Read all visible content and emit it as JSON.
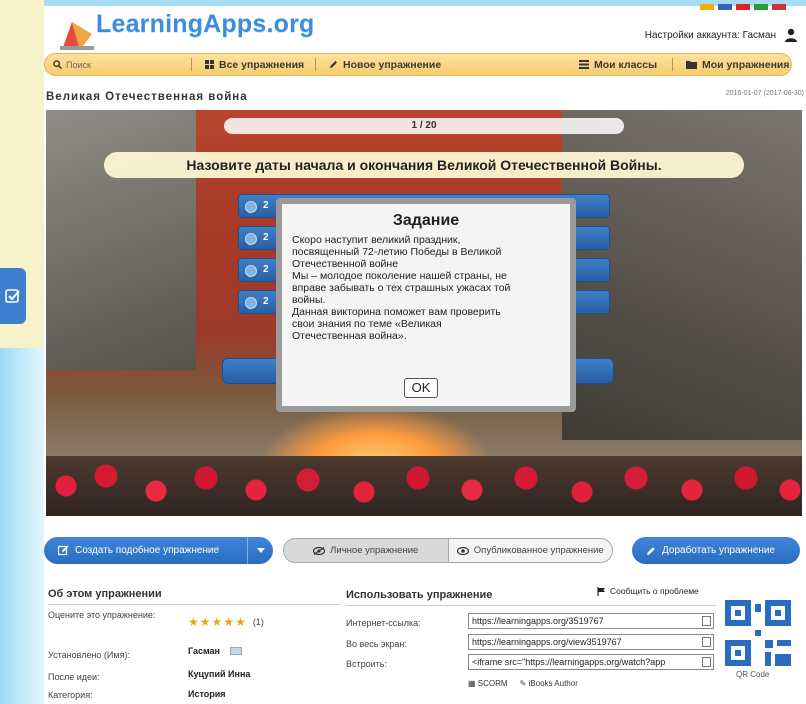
{
  "header": {
    "logo": "LearningApps.org",
    "account_label": "Настройки аккаунта: Гасман"
  },
  "nav": {
    "search_placeholder": "Поиск",
    "all_exercises": "Все упражнения",
    "new_exercise": "Новое упражнение",
    "my_classes": "Мои классы",
    "my_exercises": "Мои упражнения"
  },
  "exercise": {
    "title": "Великая Отечественная война",
    "date": "2016-01-07 (2017-06-30)"
  },
  "stage": {
    "counter": "1 / 20",
    "question": "Назовите даты начала и окончания Великой Отечественной Войны.",
    "answers": [
      "2",
      "2",
      "2",
      "2"
    ]
  },
  "modal": {
    "title": "Задание",
    "lines": [
      "Скоро наступит великий праздник,",
      "посвященный 72-летию Победы в Великой",
      "Отечественной войне",
      "Мы – молодое поколение нашей страны, не",
      "вправе забывать о тех страшных ужасах той",
      "войны.",
      "Данная викторина поможет вам проверить",
      "свои знания по теме «Великая",
      "Отечественная война»."
    ],
    "ok": "OK"
  },
  "actions": {
    "create_similar": "Создать подобное упражнение",
    "private": "Личное упражнение",
    "published": "Опубликованное упражнение",
    "improve": "Доработать упражнение"
  },
  "about": {
    "heading": "Об этом упражнении",
    "rate_label": "Оцените это упражнение:",
    "rating_count": "(1)",
    "author_label": "Установлено (Имя):",
    "author_value": "Гасман",
    "idea_label": "После идеи:",
    "idea_value": "Куцупий Инна",
    "category_label": "Категория:",
    "category_value": "История"
  },
  "use": {
    "heading": "Использовать упражнение",
    "report": "Сообщить о проблеме",
    "link_label": "Интернет-ссылка:",
    "link_value": "https://learningapps.org/3519767",
    "fullscreen_label": "Во весь экран:",
    "fullscreen_value": "https://learningapps.org/view3519767",
    "embed_label": "Встроить:",
    "embed_value": "<iframe src=\"https://learningapps.org/watch?app",
    "scorm": "SCORM",
    "ibooks": "iBooks Author",
    "qr_label": "QR Code"
  },
  "colors": {
    "accent_blue": "#2a6cc0",
    "nav_yellow": "#f7cd6c",
    "logo_blue": "#3c8de0"
  }
}
